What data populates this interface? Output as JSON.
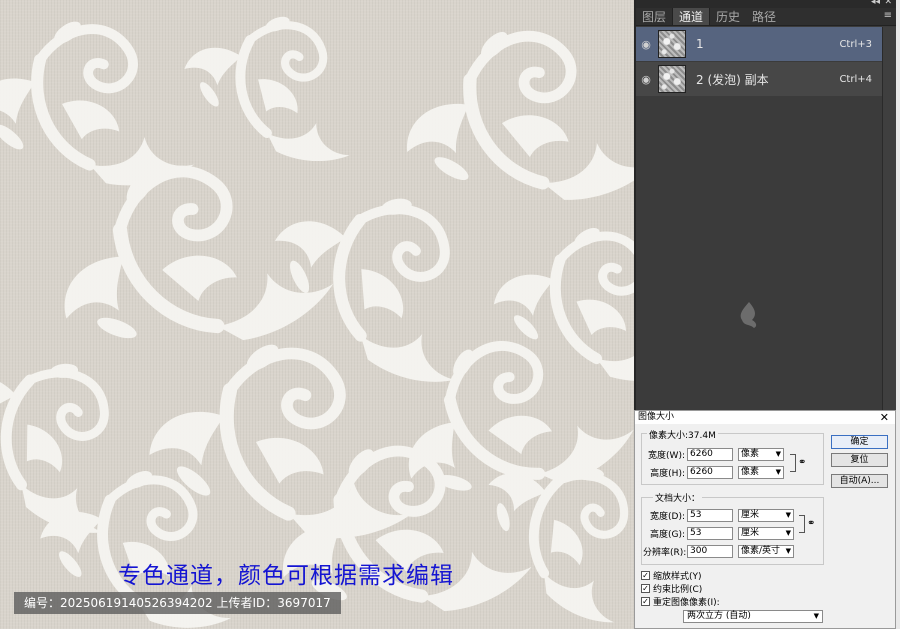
{
  "artwork": {
    "caption": "专色通道，颜色可根据需求编辑",
    "meta": "编号：20250619140526394202  上传者ID：3697017",
    "colors": {
      "background": "#d9d4cc",
      "pattern": "#f7f6f2",
      "caption": "#1414d2"
    }
  },
  "channels_panel": {
    "tabs": [
      {
        "label": "图层"
      },
      {
        "label": "通道"
      },
      {
        "label": "历史"
      },
      {
        "label": "路径"
      }
    ],
    "channels": [
      {
        "name": "1",
        "shortcut": "Ctrl+3",
        "visible_icon": "eye-icon",
        "selected": true
      },
      {
        "name": "2 (发泡) 副本",
        "shortcut": "Ctrl+4",
        "visible_icon": "eye-icon",
        "selected": false
      }
    ],
    "colors": {
      "panel_bg": "#3b3b3b",
      "selected_row": "#56647f"
    }
  },
  "image_size_dialog": {
    "title": "图像大小",
    "pixel_dimensions_label": "像素大小:37.4M",
    "width_label": "宽度(W):",
    "width_value": "6260",
    "width_unit": "像素",
    "height_label": "高度(H):",
    "height_value": "6260",
    "height_unit": "像素",
    "doc_size_label": "文档大小：",
    "doc_width_label": "宽度(D):",
    "doc_width_value": "53",
    "doc_width_unit": "厘米",
    "doc_height_label": "高度(G):",
    "doc_height_value": "53",
    "doc_height_unit": "厘米",
    "resolution_label": "分辨率(R):",
    "resolution_value": "300",
    "resolution_unit": "像素/英寸",
    "ok_label": "确定",
    "reset_label": "复位",
    "auto_label": "自动(A)...",
    "scale_styles_label": "缩放样式(Y)",
    "constrain_label": "约束比例(C)",
    "resample_label": "重定图像像素(I):",
    "resample_method": "两次立方 (自动)"
  }
}
